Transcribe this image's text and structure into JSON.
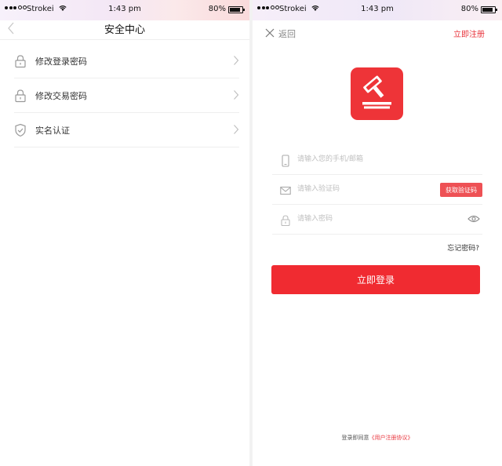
{
  "left_screen": {
    "status": {
      "carrier": "Strokei",
      "time": "1:43 pm",
      "battery": "80%"
    },
    "nav_title": "安全中心",
    "menu": [
      {
        "label": "修改登录密码",
        "icon": "lock-icon"
      },
      {
        "label": "修改交易密码",
        "icon": "lock-icon"
      },
      {
        "label": "实名认证",
        "icon": "shield-check-icon"
      }
    ]
  },
  "right_screen": {
    "status": {
      "carrier": "Strokei",
      "time": "1:43 pm",
      "battery": "80%"
    },
    "back_label": "返回",
    "register_label": "立即注册",
    "fields": {
      "phone_placeholder": "请输入您的手机/邮箱",
      "code_placeholder": "请输入验证码",
      "password_placeholder": "请输入密码"
    },
    "get_code_label": "获取验证码",
    "forgot_label": "忘记密码?",
    "login_label": "立即登录",
    "agreement_prefix": "登录即同意",
    "agreement_link": "《用户注册协议》",
    "brand_color": "#f02b31"
  }
}
